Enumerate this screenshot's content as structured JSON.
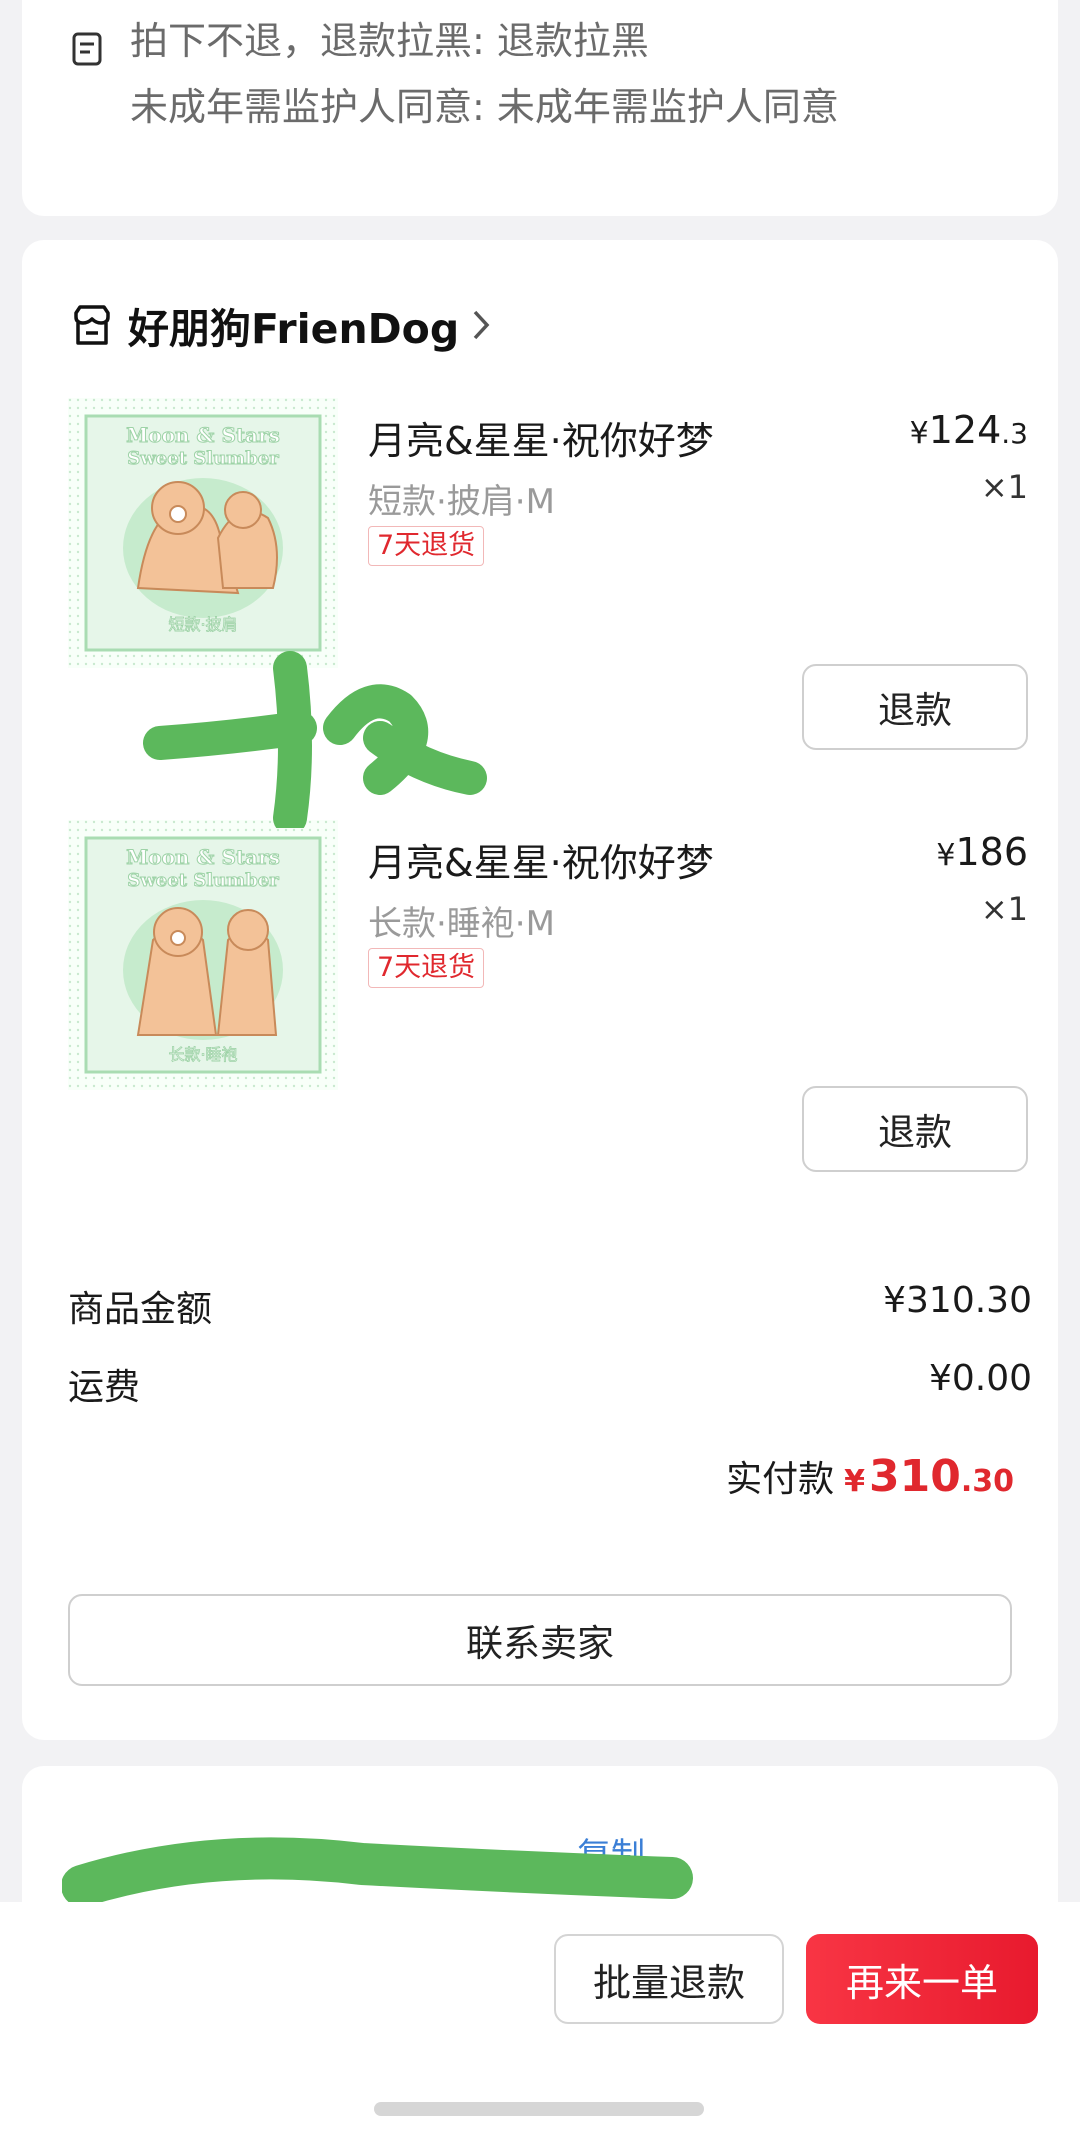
{
  "notes": {
    "line1": "拍下不退，退款拉黑: 退款拉黑",
    "line2": "未成年需监护人同意: 未成年需监护人同意"
  },
  "shop": {
    "name": "好朋狗FrienDog"
  },
  "items": [
    {
      "title": "月亮&星星·祝你好梦",
      "spec": "短款·披肩·M",
      "badge": "7天退货",
      "price_yen": "¥",
      "price_int": "124",
      "price_dec": ".3",
      "qty": "×1",
      "refund_label": "退款",
      "thumb_text_top": "Moon & Stars",
      "thumb_text_sub": "Sweet Slumber",
      "thumb_caption": "短款·披肩"
    },
    {
      "title": "月亮&星星·祝你好梦",
      "spec": "长款·睡袍·M",
      "badge": "7天退货",
      "price_yen": "¥",
      "price_int": "186",
      "price_dec": "",
      "qty": "×1",
      "refund_label": "退款",
      "thumb_text_top": "Moon & Stars",
      "thumb_text_sub": "Sweet Slumber",
      "thumb_caption": "长款·睡袍"
    }
  ],
  "summary": {
    "goods_label": "商品金额",
    "goods_value": "¥310.30",
    "shipping_label": "运费",
    "shipping_value": "¥0.00",
    "paid_label": "实付款",
    "paid_yen": "¥",
    "paid_int": "310",
    "paid_dec": ".30"
  },
  "contact_label": "联系卖家",
  "info": {
    "copy_label": "复制"
  },
  "bottom": {
    "batch_refund_label": "批量退款",
    "reorder_label": "再来一单"
  },
  "colors": {
    "accent_red": "#e0282e",
    "link_blue": "#3b7fd6",
    "thumb_green": "#a9dcb2",
    "scribble_green": "#5cb85c"
  }
}
